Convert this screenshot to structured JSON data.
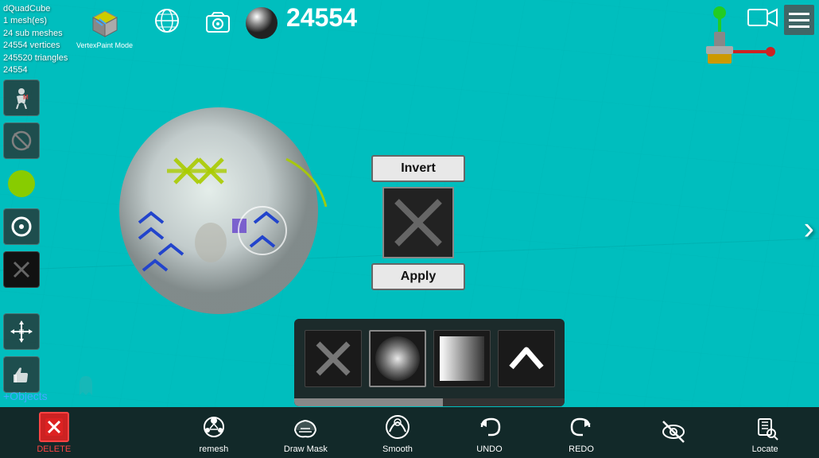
{
  "app": {
    "title": "dQuadCube",
    "mesh_count": "1 mesh(es)",
    "sub_meshes": "24 sub meshes",
    "vertices": "24554 vertices",
    "triangles": "245520 triangles",
    "id": "24554",
    "counter": "24554"
  },
  "header": {
    "vertex_paint": "VertexPaint",
    "mode": "Mode"
  },
  "toolbar": {
    "invert_label": "Invert",
    "apply_label": "Apply"
  },
  "bottom": {
    "objects_label": "+Objects",
    "delete_label": "DELETE",
    "remesh_label": "remesh",
    "draw_mask_label": "Draw Mask",
    "smooth_label": "Smooth",
    "undo_label": "UNDO",
    "redo_label": "REDO",
    "locate_label": "Locate"
  },
  "icons": {
    "menu": "hamburger-icon",
    "globe": "globe-icon",
    "camera": "camera-icon",
    "video": "video-camera-icon",
    "right_arrow": "›"
  }
}
